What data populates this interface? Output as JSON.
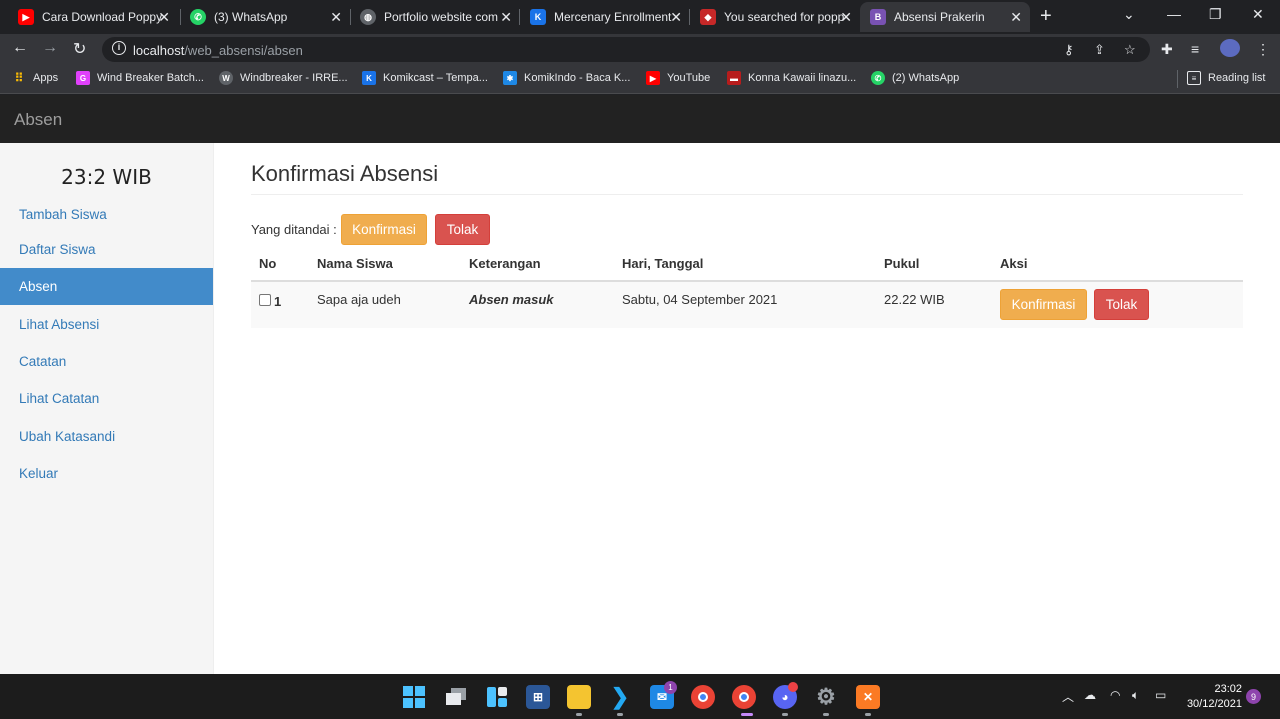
{
  "browser": {
    "tabs": [
      {
        "label": "Cara Download Poppy",
        "icon": "youtube-icon",
        "color": "#ff0000"
      },
      {
        "label": "(3) WhatsApp",
        "icon": "whatsapp-icon",
        "color": "#25d366"
      },
      {
        "label": "Portfolio website com",
        "icon": "globe-icon",
        "color": "#9aa0a6"
      },
      {
        "label": "Mercenary Enrollment",
        "icon": "komikcast-icon",
        "color": "#1a73e8"
      },
      {
        "label": "You searched for popp",
        "icon": "game-icon",
        "color": "#c62828"
      },
      {
        "label": "Absensi Prakerin",
        "icon": "bootstrap-icon",
        "color": "#7952b3"
      }
    ],
    "url_host": "localhost",
    "url_path": "/web_absensi/absen",
    "bookmarks": [
      {
        "label": "Apps",
        "icon": "apps-grid-icon",
        "color": "#ea4335"
      },
      {
        "label": "Wind Breaker Batch...",
        "icon": "g-icon",
        "color": "#e040fb"
      },
      {
        "label": "Windbreaker - IRRE...",
        "icon": "wordpress-icon",
        "color": "#9aa0a6"
      },
      {
        "label": "Komikcast – Tempa...",
        "icon": "komikcast-icon",
        "color": "#1a73e8"
      },
      {
        "label": "KomikIndo - Baca K...",
        "icon": "komikindo-icon",
        "color": "#1e88e5"
      },
      {
        "label": "YouTube",
        "icon": "youtube-icon",
        "color": "#ff0000"
      },
      {
        "label": "Konna Kawaii linazu...",
        "icon": "anime-icon",
        "color": "#b71c1c"
      },
      {
        "label": "(2) WhatsApp",
        "icon": "whatsapp-icon",
        "color": "#25d366"
      }
    ],
    "reading_list": "Reading list"
  },
  "app": {
    "brand": "Absen",
    "clock": "23:2 WIB",
    "sidebar": [
      {
        "label": "Tambah Siswa",
        "active": false
      },
      {
        "label": "Daftar Siswa",
        "active": false
      },
      {
        "label": "Absen",
        "active": true
      },
      {
        "label": "Lihat Absensi",
        "active": false
      },
      {
        "label": "Catatan",
        "active": false
      },
      {
        "label": "Lihat Catatan",
        "active": false
      },
      {
        "label": "Ubah Katasandi",
        "active": false
      },
      {
        "label": "Keluar",
        "active": false
      }
    ],
    "title": "Konfirmasi Absensi",
    "marked_label": "Yang ditandai :",
    "confirm_label": "Konfirmasi",
    "reject_label": "Tolak",
    "table": {
      "headers": [
        "No",
        "Nama Siswa",
        "Keterangan",
        "Hari, Tanggal",
        "Pukul",
        "Aksi"
      ],
      "rows": [
        {
          "no": "1",
          "nama": "Sapa aja udeh",
          "keterangan": "Absen masuk",
          "tanggal": "Sabtu, 04 September 2021",
          "pukul": "22.22 WIB",
          "checked": false
        }
      ]
    }
  },
  "taskbar": {
    "time": "23:02",
    "date": "30/12/2021",
    "notifications": "9",
    "mail_badge": "1"
  },
  "colors": {
    "primary": "#428bca",
    "warning": "#f0ad4e",
    "danger": "#d9534f",
    "navbar": "#222222"
  }
}
